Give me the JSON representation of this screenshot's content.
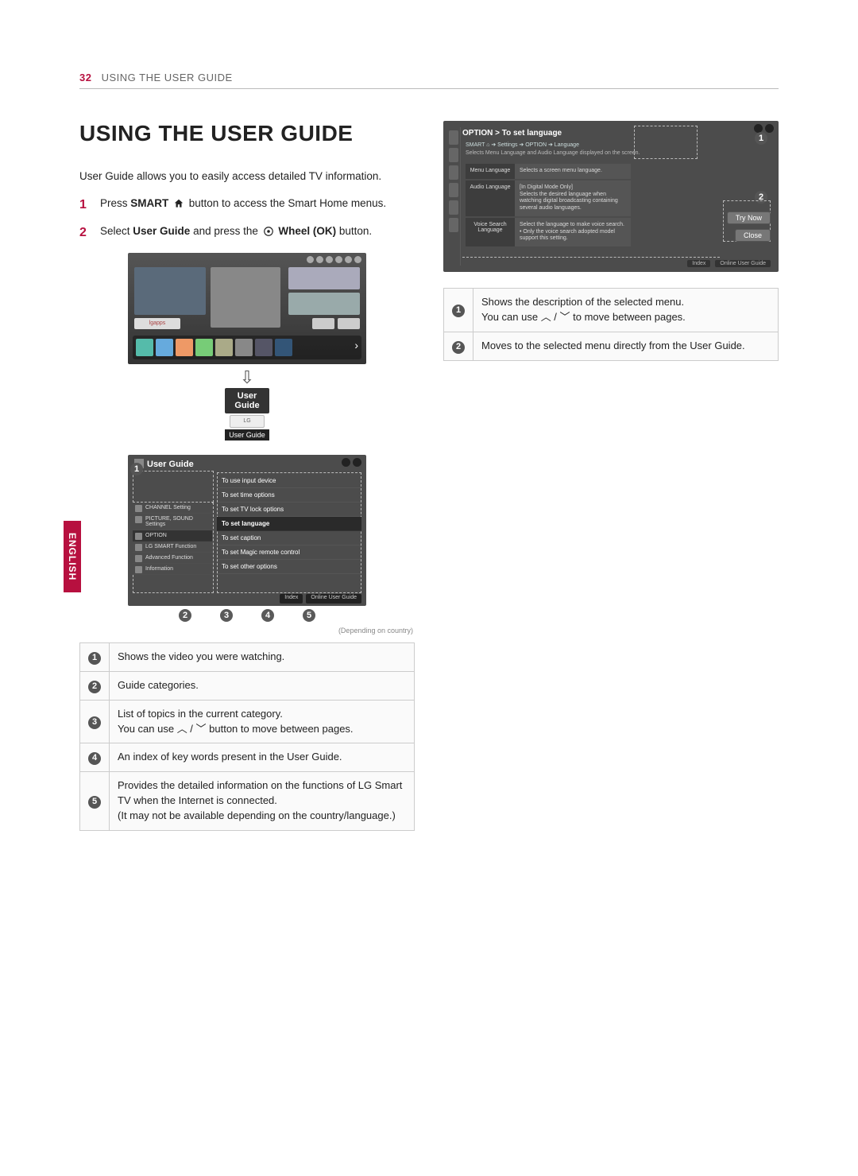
{
  "page": {
    "number": "32",
    "header": "USING THE USER GUIDE",
    "language_tab": "ENGLISH"
  },
  "section": {
    "title": "USING THE USER GUIDE",
    "intro": "User Guide allows you to easily access detailed TV information.",
    "steps": [
      {
        "num": "1",
        "pre": "Press ",
        "bold": "SMART ",
        "post": " button to access the Smart Home menus."
      },
      {
        "num": "2",
        "pre": "Select ",
        "bold": "User Guide",
        "mid": " and press the ",
        "bold2": "Wheel (OK)",
        "post": " button."
      }
    ]
  },
  "home_mock": {
    "app_label": "lgapps",
    "tile_title": "User\nGuide",
    "tile_sub": "LG",
    "tile_caption": "User Guide"
  },
  "ug_mock": {
    "title": "User Guide",
    "left_items": [
      "CHANNEL Setting",
      "PICTURE, SOUND Settings",
      "OPTION",
      "LG SMART Function",
      "Advanced Function",
      "Information"
    ],
    "left_selected_index": 2,
    "right_items": [
      "To use input device",
      "To set time options",
      "To set TV lock options",
      "To set language",
      "To set caption",
      "To set Magic remote control",
      "To set other options"
    ],
    "right_selected_index": 3,
    "footer": [
      "Index",
      "Online User Guide"
    ],
    "depending": "(Depending on country)"
  },
  "ug_table": [
    "Shows the video you were watching.",
    "Guide categories.",
    "List of topics in the current category.\nYou can use ︿ / ﹀ button to move between pages.",
    "An index of key words present in the User Guide.",
    "Provides the detailed information on the functions of LG Smart TV when the Internet is connected.\n(It may not be available depending on the country/language.)"
  ],
  "lang_mock": {
    "breadcrumb": "OPTION > To set language",
    "crumb_line1": "SMART ⌂ ➔ Settings ➔ OPTION ➔ Language",
    "crumb_line2": "Selects Menu Language and Audio Language displayed on the screen.",
    "rows": [
      {
        "l": "Menu Language",
        "r": "Selects a screen menu language."
      },
      {
        "l": "Audio Language",
        "r": "[In Digital Mode Only]\nSelects the desired language when watching digital broadcasting containing several audio languages."
      },
      {
        "l": "Voice Search Language",
        "r": "Select the language to make voice search.\n• Only the voice search adopted model support this setting."
      }
    ],
    "btn_try": "Try Now",
    "btn_close": "Close",
    "foot": [
      "Index",
      "Online User Guide"
    ]
  },
  "lang_table": [
    "Shows the description of the selected menu.\nYou can use ︿ / ﹀ to move between pages.",
    "Moves to the selected menu directly from the User Guide."
  ]
}
